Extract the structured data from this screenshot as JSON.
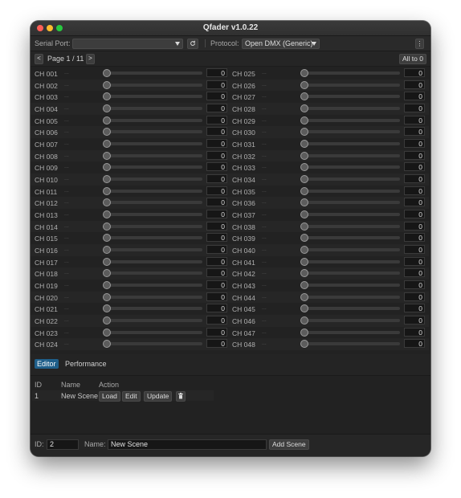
{
  "window": {
    "title": "Qfader v1.0.22"
  },
  "toolbar": {
    "serial_port_label": "Serial Port:",
    "serial_port_value": "",
    "protocol_label": "Protocol:",
    "protocol_value": "Open DMX (Generic)"
  },
  "pager": {
    "prev": "<",
    "page_label": "Page 1 / 11",
    "next": ">",
    "all_to_zero": "All to 0"
  },
  "channels_left": [
    {
      "label": "CH 001",
      "dots": "...",
      "value": "0"
    },
    {
      "label": "CH 002",
      "dots": "...",
      "value": "0"
    },
    {
      "label": "CH 003",
      "dots": "...",
      "value": "0"
    },
    {
      "label": "CH 004",
      "dots": "...",
      "value": "0"
    },
    {
      "label": "CH 005",
      "dots": "...",
      "value": "0"
    },
    {
      "label": "CH 006",
      "dots": "...",
      "value": "0"
    },
    {
      "label": "CH 007",
      "dots": "...",
      "value": "0"
    },
    {
      "label": "CH 008",
      "dots": "...",
      "value": "0"
    },
    {
      "label": "CH 009",
      "dots": "...",
      "value": "0"
    },
    {
      "label": "CH 010",
      "dots": "...",
      "value": "0"
    },
    {
      "label": "CH 011",
      "dots": "...",
      "value": "0"
    },
    {
      "label": "CH 012",
      "dots": "...",
      "value": "0"
    },
    {
      "label": "CH 013",
      "dots": "...",
      "value": "0"
    },
    {
      "label": "CH 014",
      "dots": "...",
      "value": "0"
    },
    {
      "label": "CH 015",
      "dots": "...",
      "value": "0"
    },
    {
      "label": "CH 016",
      "dots": "...",
      "value": "0"
    },
    {
      "label": "CH 017",
      "dots": "...",
      "value": "0"
    },
    {
      "label": "CH 018",
      "dots": "...",
      "value": "0"
    },
    {
      "label": "CH 019",
      "dots": "...",
      "value": "0"
    },
    {
      "label": "CH 020",
      "dots": "...",
      "value": "0"
    },
    {
      "label": "CH 021",
      "dots": "...",
      "value": "0"
    },
    {
      "label": "CH 022",
      "dots": "...",
      "value": "0"
    },
    {
      "label": "CH 023",
      "dots": "...",
      "value": "0"
    },
    {
      "label": "CH 024",
      "dots": "...",
      "value": "0"
    }
  ],
  "channels_right": [
    {
      "label": "CH 025",
      "dots": "...",
      "value": "0"
    },
    {
      "label": "CH 026",
      "dots": "...",
      "value": "0"
    },
    {
      "label": "CH 027",
      "dots": "...",
      "value": "0"
    },
    {
      "label": "CH 028",
      "dots": "...",
      "value": "0"
    },
    {
      "label": "CH 029",
      "dots": "...",
      "value": "0"
    },
    {
      "label": "CH 030",
      "dots": "...",
      "value": "0"
    },
    {
      "label": "CH 031",
      "dots": "...",
      "value": "0"
    },
    {
      "label": "CH 032",
      "dots": "...",
      "value": "0"
    },
    {
      "label": "CH 033",
      "dots": "...",
      "value": "0"
    },
    {
      "label": "CH 034",
      "dots": "...",
      "value": "0"
    },
    {
      "label": "CH 035",
      "dots": "...",
      "value": "0"
    },
    {
      "label": "CH 036",
      "dots": "...",
      "value": "0"
    },
    {
      "label": "CH 037",
      "dots": "...",
      "value": "0"
    },
    {
      "label": "CH 038",
      "dots": "...",
      "value": "0"
    },
    {
      "label": "CH 039",
      "dots": "...",
      "value": "0"
    },
    {
      "label": "CH 040",
      "dots": "...",
      "value": "0"
    },
    {
      "label": "CH 041",
      "dots": "...",
      "value": "0"
    },
    {
      "label": "CH 042",
      "dots": "...",
      "value": "0"
    },
    {
      "label": "CH 043",
      "dots": "...",
      "value": "0"
    },
    {
      "label": "CH 044",
      "dots": "...",
      "value": "0"
    },
    {
      "label": "CH 045",
      "dots": "...",
      "value": "0"
    },
    {
      "label": "CH 046",
      "dots": "...",
      "value": "0"
    },
    {
      "label": "CH 047",
      "dots": "...",
      "value": "0"
    },
    {
      "label": "CH 048",
      "dots": "...",
      "value": "0"
    }
  ],
  "tabs": [
    {
      "label": "Editor",
      "active": true
    },
    {
      "label": "Performance",
      "active": false
    }
  ],
  "scenes": {
    "headers": {
      "id": "ID",
      "name": "Name",
      "action": "Action"
    },
    "rows": [
      {
        "id": "1",
        "name": "New Scene",
        "load": "Load",
        "edit": "Edit",
        "update": "Update"
      }
    ]
  },
  "footer": {
    "id_label": "ID:",
    "id_value": "2",
    "name_label": "Name:",
    "name_value": "New Scene",
    "add_scene": "Add Scene"
  },
  "colors": {
    "accent": "#1f5f8a",
    "close": "#ff5f57",
    "minimize": "#febc2e",
    "maximize": "#28c840"
  },
  "icons": {
    "refresh": "refresh-icon",
    "more": "more-vertical-icon",
    "delete": "trash-icon"
  }
}
